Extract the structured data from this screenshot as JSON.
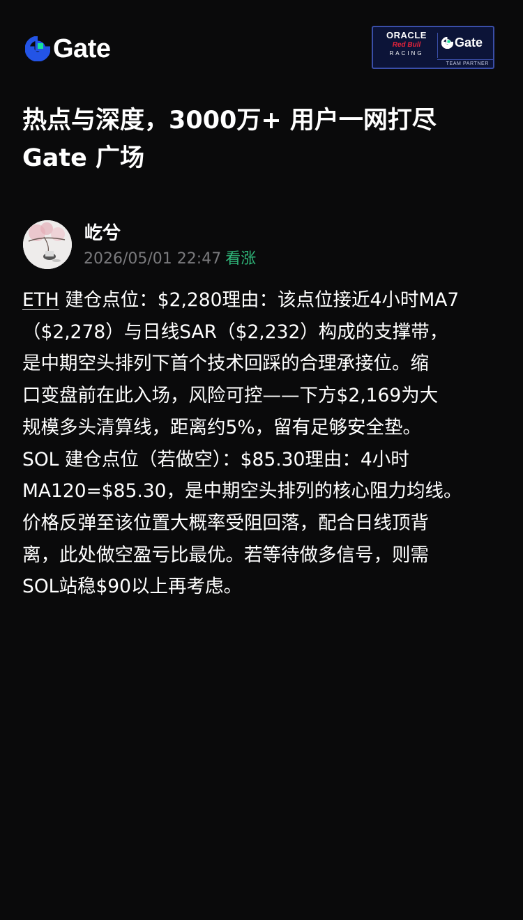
{
  "header": {
    "brand_name": "Gate",
    "brand_icon": "gate-logo-icon",
    "partner_badge": {
      "oracle": "ORACLE",
      "red_bull": "Red Bull",
      "racing": "RACING",
      "gate": "Gate",
      "team_partner": "TEAM PARTNER"
    }
  },
  "headline": {
    "line1": "热点与深度，3000万+ 用户一网打尽",
    "line2": "Gate 广场"
  },
  "post": {
    "author": "屹兮",
    "timestamp": "2026/05/01 22:47",
    "sentiment": "看涨",
    "ticker": "ETH",
    "body_lines": [
      " 建仓点位：$2,280理由：该点位接近4小时MA7",
      "（$2,278）与日线SAR（$2,232）构成的支撑带，",
      "是中期空头排列下首个技术回踩的合理承接位。缩",
      "口变盘前在此入场，风险可控——下方$2,169为大",
      "规模多头清算线，距离约5%，留有足够安全垫。",
      "SOL 建仓点位（若做空）：$85.30理由：4小时",
      "MA120=$85.30，是中期空头排列的核心阻力均线。",
      "价格反弹至该位置大概率受阻回落，配合日线顶背",
      "离，此处做空盈亏比最优。若等待做多信号，则需",
      "SOL站稳$90以上再考虑。"
    ]
  },
  "colors": {
    "background": "#0a0a0b",
    "brand_blue": "#2354e6",
    "brand_green": "#17e39a",
    "bullish_green": "#2fb77a",
    "meta_gray": "#7a7a7d"
  }
}
